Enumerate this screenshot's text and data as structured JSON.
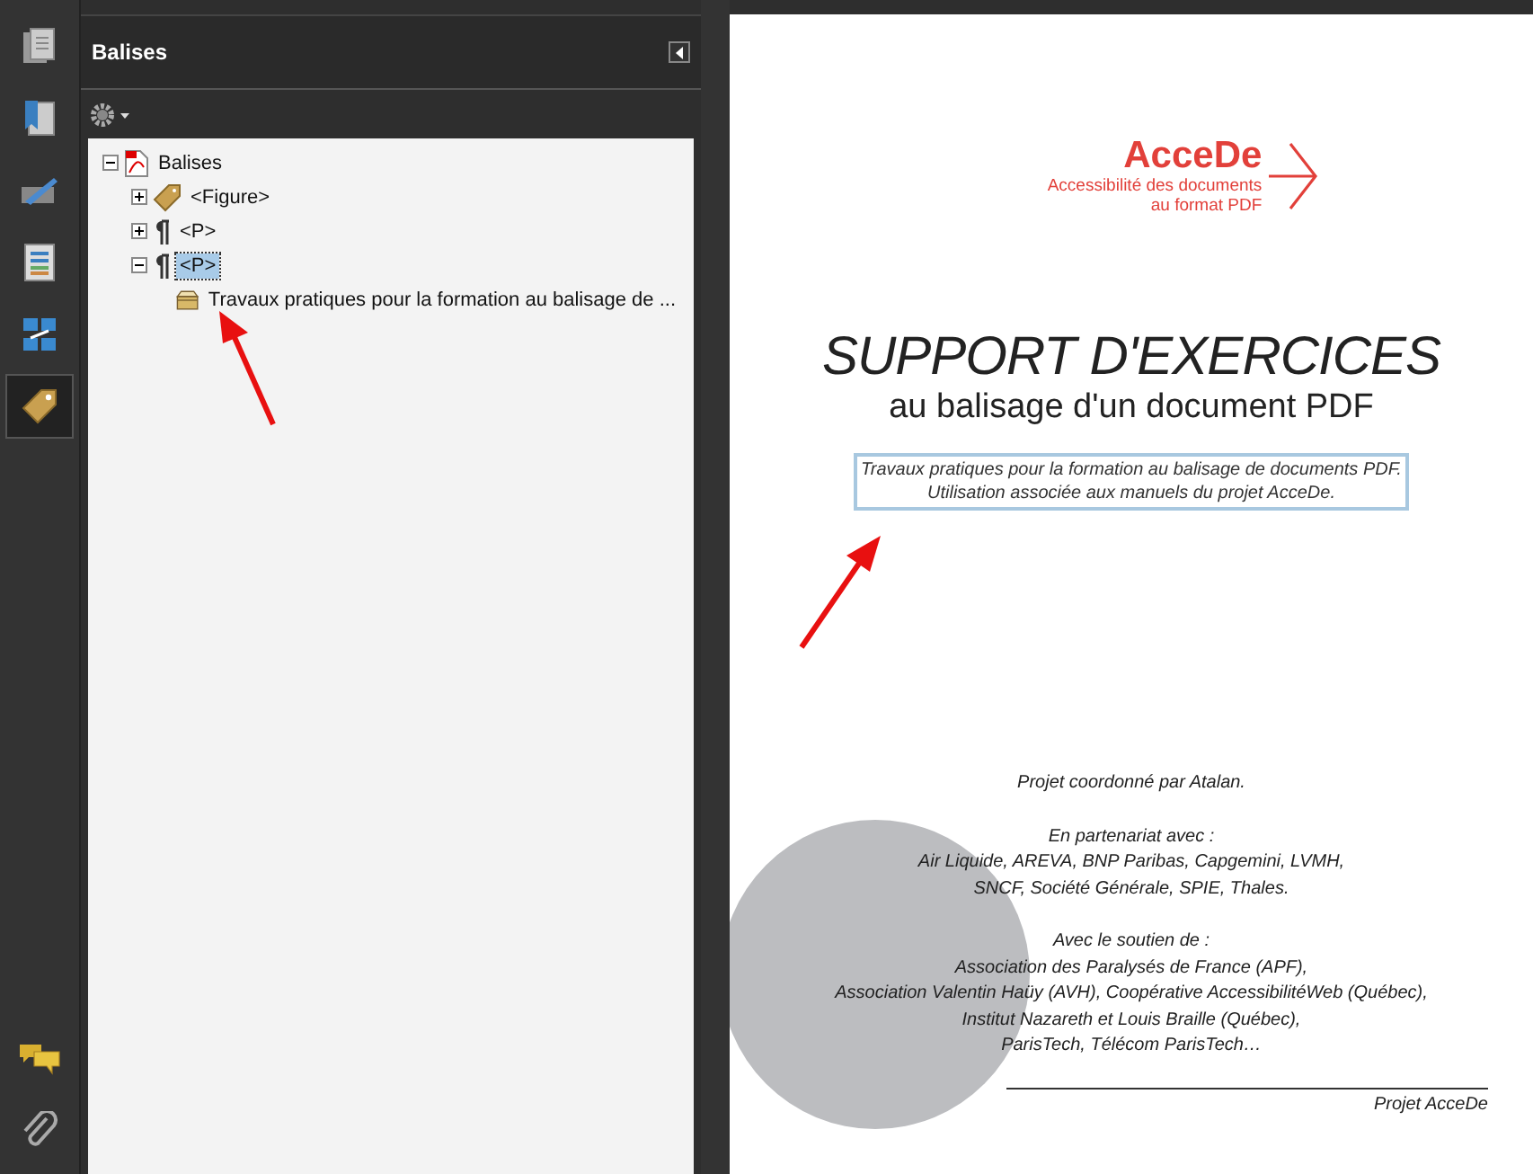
{
  "sidebar": {
    "top_icons": [
      {
        "kind": "pages",
        "selected": false
      },
      {
        "kind": "bookmarks",
        "selected": false
      },
      {
        "kind": "signatures",
        "selected": false
      },
      {
        "kind": "document",
        "selected": false
      },
      {
        "kind": "model",
        "selected": false
      },
      {
        "kind": "tags",
        "selected": true
      }
    ],
    "bottom_icons": [
      {
        "kind": "comments",
        "selected": false
      },
      {
        "kind": "attachment",
        "selected": false
      }
    ]
  },
  "panel": {
    "title": "Balises",
    "tree": [
      {
        "label": "Balises",
        "kind": "pdf",
        "expanded": true,
        "selected": false,
        "children": [
          {
            "label": "<Figure>",
            "kind": "tag",
            "expanded": false,
            "selected": false
          },
          {
            "label": "<P>",
            "kind": "paragraph",
            "expanded": false,
            "selected": false
          },
          {
            "label": "<P>",
            "kind": "paragraph",
            "expanded": true,
            "selected": true,
            "children": [
              {
                "label": "Travaux pratiques pour la formation au balisage de ...",
                "kind": "content",
                "selected": false
              }
            ]
          }
        ]
      }
    ]
  },
  "document": {
    "logo": {
      "name": "AcceDe",
      "tagline": [
        "Accessibilité des documents",
        "au format PDF"
      ]
    },
    "title": "SUPPORT D'EXERCICES",
    "subtitle": "au balisage d'un document PDF",
    "highlighted_text": [
      "Travaux pratiques pour la formation au balisage de documents PDF.",
      "Utilisation associée aux manuels du projet AcceDe."
    ],
    "paragraphs": [
      [
        "Projet coordonné par Atalan."
      ],
      [
        "En partenariat avec :",
        "Air Liquide, AREVA, BNP Paribas, Capgemini, LVMH,",
        "SNCF, Société Générale, SPIE, Thales."
      ],
      [
        "Avec le soutien de :",
        "Association des Paralysés de France (APF),",
        "Association Valentin Haüy (AVH), Coopérative AccessibilitéWeb (Québec),",
        "Institut Nazareth et Louis Braille (Québec),",
        "ParisTech, Télécom ParisTech…"
      ]
    ],
    "footer": "Projet AcceDe"
  }
}
